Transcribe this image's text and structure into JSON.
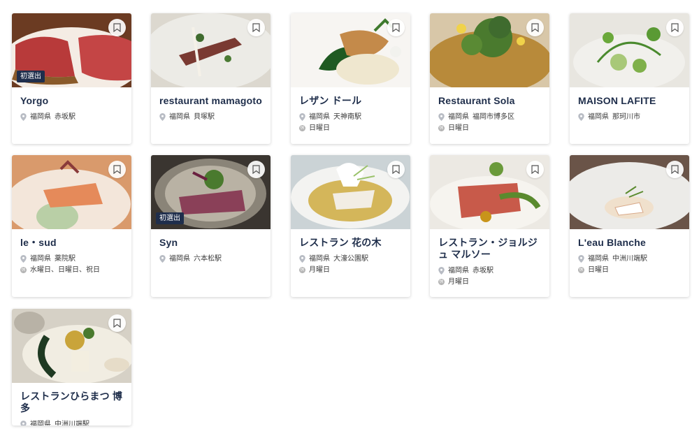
{
  "badge_label": "初選出",
  "cards": [
    {
      "name": "Yorgo",
      "prefecture": "福岡県",
      "station": "赤坂駅",
      "holiday": "",
      "badge": true,
      "food": "beef"
    },
    {
      "name": "restaurant mamagoto",
      "prefecture": "福岡県",
      "station": "貝塚駅",
      "holiday": "",
      "badge": false,
      "food": "plate"
    },
    {
      "name": "レザン ドール",
      "prefecture": "福岡県",
      "station": "天神南駅",
      "holiday": "日曜日",
      "badge": false,
      "food": "fish-green"
    },
    {
      "name": "Restaurant Sola",
      "prefecture": "福岡県",
      "station": "福岡市博多区",
      "holiday": "日曜日",
      "badge": false,
      "food": "herbs"
    },
    {
      "name": "MAISON LAFITE",
      "prefecture": "福岡県",
      "station": "那珂川市",
      "holiday": "",
      "badge": false,
      "food": "sprouts"
    },
    {
      "name": "le・sud",
      "prefecture": "福岡県",
      "station": "薬院駅",
      "holiday": "水曜日、日曜日、祝日",
      "badge": false,
      "food": "salmon"
    },
    {
      "name": "Syn",
      "prefecture": "福岡県",
      "station": "六本松駅",
      "holiday": "",
      "badge": true,
      "food": "duck"
    },
    {
      "name": "レストラン 花の木",
      "prefecture": "福岡県",
      "station": "大濠公園駅",
      "holiday": "月曜日",
      "badge": false,
      "food": "soup"
    },
    {
      "name": "レストラン・ジョルジュ マルソー",
      "prefecture": "福岡県",
      "station": "赤坂駅",
      "holiday": "月曜日",
      "badge": false,
      "food": "snapper"
    },
    {
      "name": "L'eau Blanche",
      "prefecture": "福岡県",
      "station": "中洲川端駅",
      "holiday": "日曜日",
      "badge": false,
      "food": "bowl"
    },
    {
      "name": "レストランひらまつ 博多",
      "prefecture": "福岡県",
      "station": "中洲川端駅",
      "holiday": "",
      "badge": false,
      "food": "clam"
    }
  ]
}
